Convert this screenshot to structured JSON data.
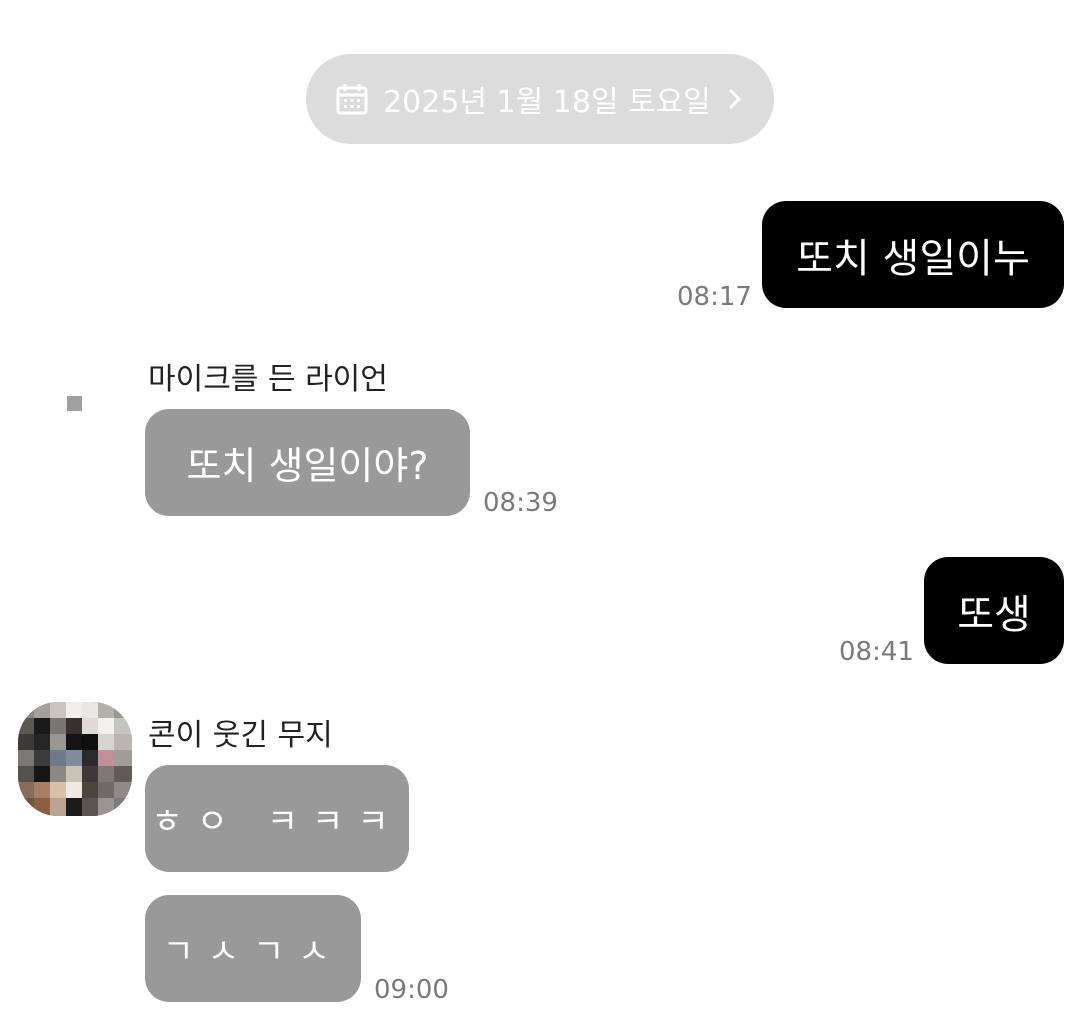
{
  "date_divider": {
    "icon": "calendar-icon",
    "label": "2025년 1월 18일 토요일",
    "chevron_icon": "chevron-right-icon"
  },
  "messages": [
    {
      "side": "me",
      "text": "또치 생일이누",
      "time": "08:17"
    },
    {
      "side": "other",
      "sender": "마이크를 든 라이언",
      "text": "또치 생일이야?",
      "time": "08:39"
    },
    {
      "side": "me",
      "text": "또생",
      "time": "08:41"
    },
    {
      "side": "other",
      "sender": "콘이 웃긴 무지",
      "text": "ㅎㅇ ㅋㅋㅋ",
      "time": ""
    },
    {
      "side": "other",
      "text": "ㄱㅅㄱㅅ",
      "time": "09:00"
    }
  ],
  "colors": {
    "my_bubble": "#000000",
    "other_bubble": "#999999",
    "date_pill": "#dcdcdc",
    "background": "#ffffff"
  }
}
